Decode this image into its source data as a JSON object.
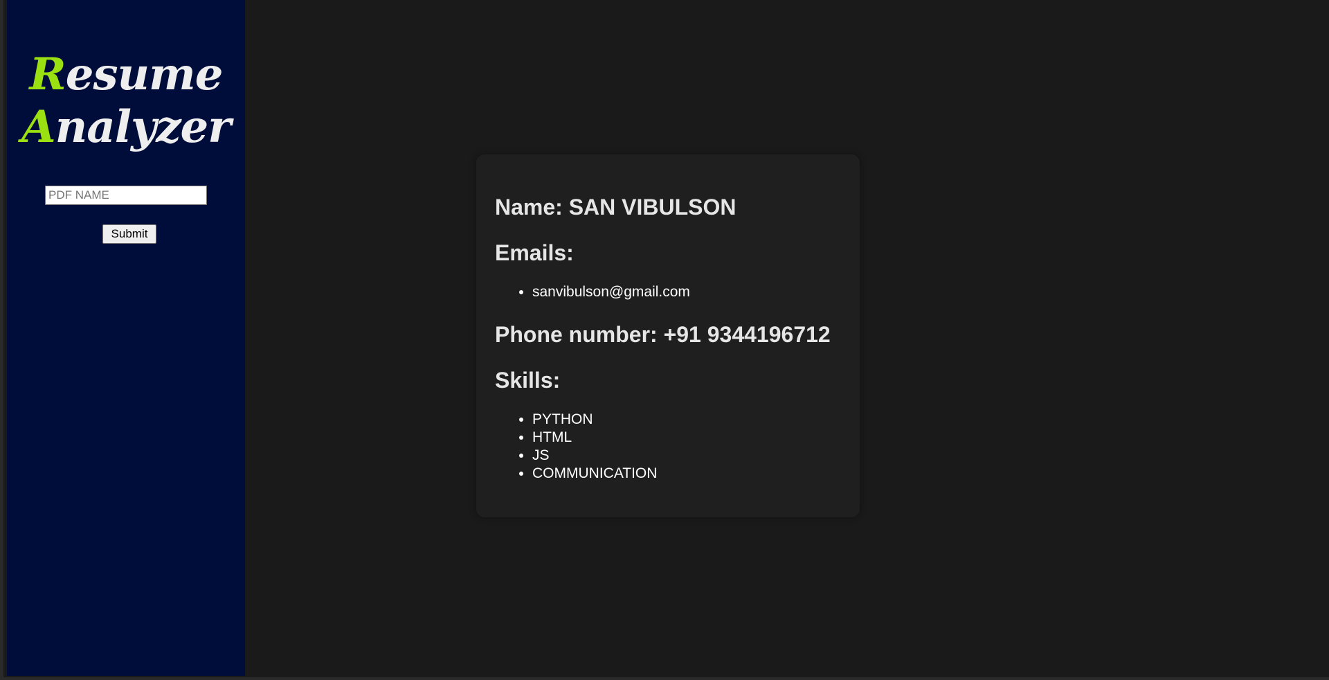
{
  "sidebar": {
    "logo": {
      "line1_first": "R",
      "line1_rest": "esume",
      "line2_first": "A",
      "line2_rest": "nalyzer"
    },
    "pdf_input": {
      "placeholder": "PDF NAME",
      "value": ""
    },
    "submit_label": "Submit"
  },
  "resume": {
    "name_heading": "Name: SAN VIBULSON",
    "emails_heading": "Emails:",
    "emails": [
      "sanvibulson@gmail.com"
    ],
    "phone_heading": "Phone number: +91 9344196712",
    "skills_heading": "Skills:",
    "skills": [
      "PYTHON",
      "HTML",
      "JS",
      "COMMUNICATION"
    ]
  },
  "colors": {
    "sidebar_bg": "#000d3a",
    "page_bg": "#1a1a1a",
    "card_bg": "#1f1f1f",
    "logo_accent": "#9be011",
    "logo_text": "#eeeeee"
  }
}
